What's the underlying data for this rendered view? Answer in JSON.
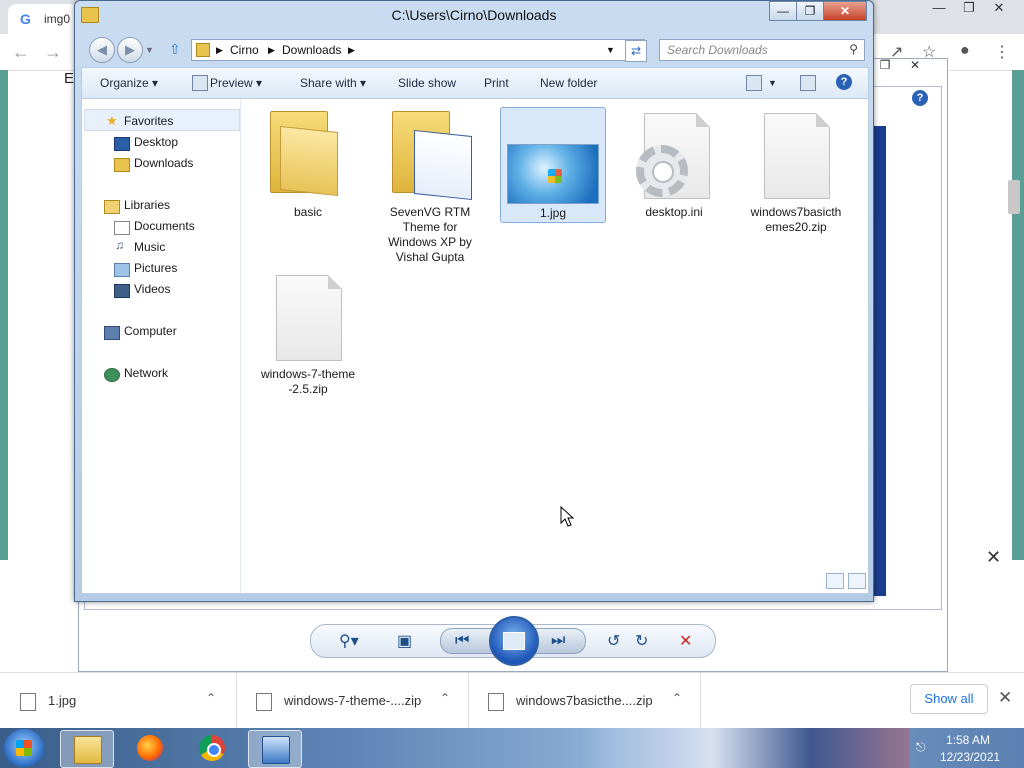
{
  "browser": {
    "tab_title": "img0",
    "partial_text": "E"
  },
  "explorer": {
    "title": "C:\\Users\\Cirno\\Downloads",
    "breadcrumb": [
      "Cirno",
      "Downloads"
    ],
    "search_placeholder": "Search Downloads",
    "commands": [
      "Organize",
      "Preview",
      "Share with",
      "Slide show",
      "Print",
      "New folder"
    ],
    "nav": {
      "favorites": {
        "label": "Favorites",
        "items": [
          "Desktop",
          "Downloads"
        ]
      },
      "libraries": {
        "label": "Libraries",
        "items": [
          "Documents",
          "Music",
          "Pictures",
          "Videos"
        ]
      },
      "computer": "Computer",
      "network": "Network"
    },
    "files": [
      {
        "name": "basic",
        "type": "folder"
      },
      {
        "name": "SevenVG RTM Theme for Windows XP by Vishal Gupta",
        "type": "folder"
      },
      {
        "name": "1.jpg",
        "type": "image",
        "selected": true
      },
      {
        "name": "desktop.ini",
        "type": "settings"
      },
      {
        "name": "windows7basicthemes20.zip",
        "type": "zip"
      },
      {
        "name": "windows-7-theme-2.5.zip",
        "type": "zip"
      }
    ]
  },
  "downloads": {
    "items": [
      "1.jpg",
      "windows-7-theme-....zip",
      "windows7basicthe....zip"
    ],
    "show_all": "Show all"
  },
  "taskbar": {
    "time": "1:58 AM",
    "date": "12/23/2021"
  }
}
